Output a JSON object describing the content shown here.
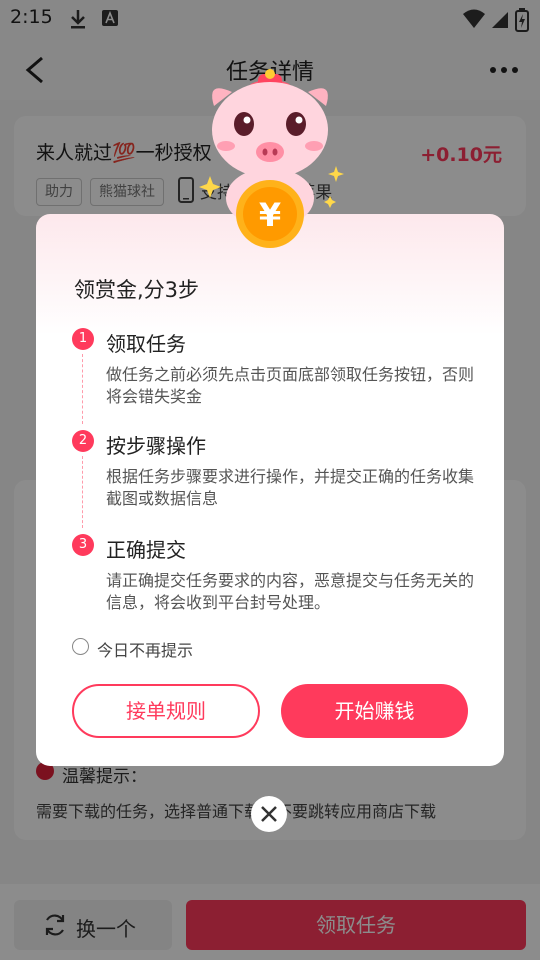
{
  "status_bar": {
    "time": "2:15",
    "icons": [
      "download-icon",
      "app-notification-icon",
      "wifi-icon",
      "signal-icon",
      "battery-charging-icon"
    ]
  },
  "header": {
    "title": "任务详情",
    "back_icon": "back-arrow-icon",
    "more_icon": "more-dots-icon"
  },
  "task": {
    "title": "来人就过💯一秒授权",
    "reward": "+0.10元",
    "tags": [
      "助力",
      "熊猫球社"
    ],
    "platform_icon": "phone-icon",
    "platform": "支持：安卓&苹果"
  },
  "tips": {
    "title": "温馨提示：",
    "text": "需要下载的任务，选择普通下载，不要跳转应用商店下载"
  },
  "bottom_bar": {
    "switch_label": "换一个",
    "switch_icon": "refresh-icon",
    "claim_label": "领取任务"
  },
  "modal": {
    "title": "领赏金,分3步",
    "steps": [
      {
        "num": "1",
        "title": "领取任务",
        "desc": "做任务之前必须先点击页面底部领取任务按钮，否则将会错失奖金"
      },
      {
        "num": "2",
        "title": "按步骤操作",
        "desc": "根据任务步骤要求进行操作，并提交正确的任务收集截图或数据信息"
      },
      {
        "num": "3",
        "title": "正确提交",
        "desc": "请正确提交任务要求的内容，恶意提交与任务无关的信息，将会收到平台封号处理。"
      }
    ],
    "checkbox_label": "今日不再提示",
    "rules_label": "接单规则",
    "start_label": "开始赚钱",
    "mascot_icon": "pig-mascot-with-coin-icon",
    "coin_symbol": "¥"
  },
  "close_icon": "close-icon",
  "colors": {
    "accent": "#ff3a5c",
    "overlay": "rgba(0,0,0,0.45)"
  }
}
